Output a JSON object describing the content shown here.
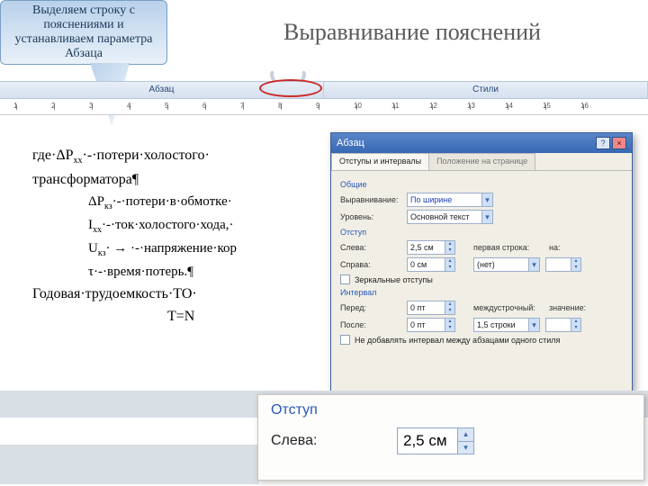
{
  "callout": {
    "text": "Выделяем строку с пояснениями и устанавливаем параметра Абзаца"
  },
  "title": "Выравнивание пояснений",
  "ribbon": {
    "group1": "Абзац",
    "group2": "Стили"
  },
  "ruler_nums": [
    "1",
    "2",
    "3",
    "4",
    "5",
    "6",
    "7",
    "8",
    "9",
    "10",
    "11",
    "12",
    "13",
    "14",
    "15",
    "16"
  ],
  "doc": {
    "l1a": "где·ΔР",
    "l1sub": "хх",
    "l1b": "·-·потери·холостого·",
    "l2": "трансформатора¶",
    "l3a": "ΔР",
    "l3sub": "кз",
    "l3b": "·-·потери·в·обмотке·",
    "l4a": "I",
    "l4sub": "хх",
    "l4b": "·-·ток·холостого·хода,·",
    "l5a": "U",
    "l5sub": "кз",
    "l5b": "· → ·-·напряжение·кор",
    "l6": "τ·-·время·потерь.¶",
    "l7": "Годовая·трудоемкость·ТО·",
    "l8a": "T",
    "l8b": "=N"
  },
  "dialog": {
    "title": "Абзац",
    "help": "?",
    "close": "×",
    "tab1": "Отступы и интервалы",
    "tab2": "Положение на странице",
    "grp_general": "Общие",
    "align_lbl": "Выравнивание:",
    "align_val": "По ширине",
    "level_lbl": "Уровень:",
    "level_val": "Основной текст",
    "grp_indent": "Отступ",
    "left_lbl": "Слева:",
    "left_val": "2,5 см",
    "right_lbl": "Справа:",
    "right_val": "0 см",
    "first_lbl": "первая строка:",
    "first_val": "(нет)",
    "on_lbl": "на:",
    "mirror_chk": "Зеркальные отступы",
    "grp_spacing": "Интервал",
    "before_lbl": "Перед:",
    "before_val": "0 пт",
    "after_lbl": "После:",
    "after_val": "0 пт",
    "line_lbl": "междустрочный:",
    "line_val": "1,5 строки",
    "val_lbl": "значение:",
    "noadd_chk": "Не добавлять интервал между абзацами одного стиля"
  },
  "zoom": {
    "group": "Отступ",
    "left_lbl": "Слева:",
    "left_val": "2,5 см"
  }
}
